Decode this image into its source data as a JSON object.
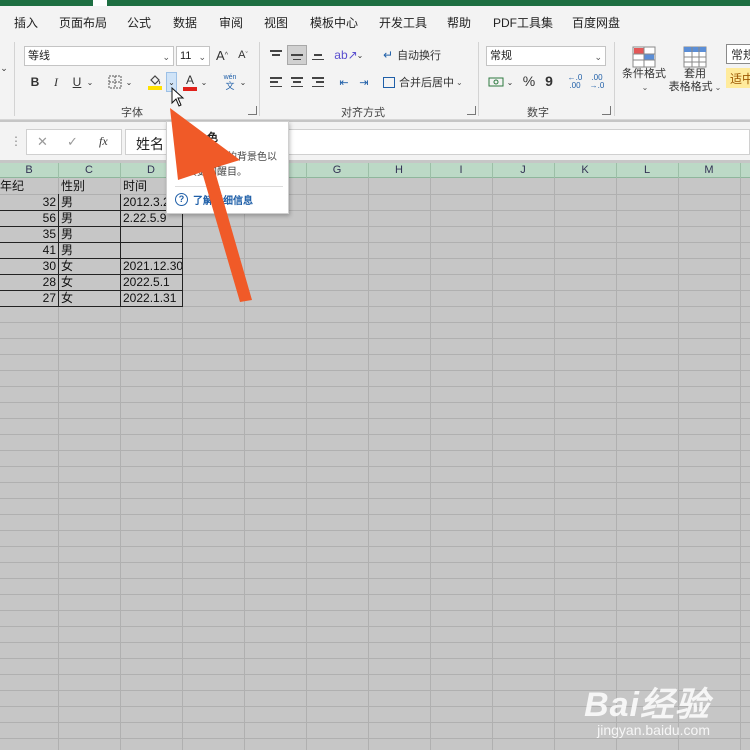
{
  "menu": {
    "tabs": [
      "插入",
      "页面布局",
      "公式",
      "数据",
      "审阅",
      "视图",
      "模板中心",
      "开发工具",
      "帮助",
      "PDF工具集",
      "百度网盘"
    ]
  },
  "ribbon": {
    "font_name": "等线",
    "font_size": "11",
    "grow_font": "A",
    "shrink_font": "A",
    "bold": "B",
    "italic": "I",
    "underline": "U",
    "font_color_letter": "A",
    "phonetic_top": "wén",
    "phonetic_bottom": "文",
    "group_font": "字体",
    "wrap_text": "自动换行",
    "merge_center": "合并后居中",
    "group_alignment": "对齐方式",
    "number_format": "常规",
    "percent": "%",
    "comma": "9",
    "group_number": "数字",
    "cond_format": "条件格式",
    "table_format_1": "套用",
    "table_format_2": "表格格式",
    "style_normal": "常规",
    "style_moderate": "适中",
    "colors": {
      "fill_yellow": "#ffe100",
      "font_red": "#e0201a",
      "menubar_green": "#1e6f42"
    }
  },
  "formula_bar": {
    "cancel": "✕",
    "confirm": "✓",
    "fx": "fx",
    "content": "姓名"
  },
  "columns": [
    "B",
    "C",
    "D",
    "E",
    "F",
    "G",
    "H",
    "I",
    "J",
    "K",
    "L",
    "M"
  ],
  "table": {
    "headers": [
      "年纪",
      "性别",
      "时间"
    ],
    "rows": [
      [
        "32",
        "男",
        "2012.3.2"
      ],
      [
        "56",
        "男",
        "2.22.5.9"
      ],
      [
        "35",
        "男",
        ""
      ],
      [
        "41",
        "男",
        ""
      ],
      [
        "30",
        "女",
        "2021.12.30"
      ],
      [
        "28",
        "女",
        "2022.5.1"
      ],
      [
        "27",
        "女",
        "2022.1.31"
      ]
    ]
  },
  "tooltip": {
    "title": "色",
    "description": "设置单元格的背景色以使其更加醒目。",
    "help_link": "了解详细信息"
  },
  "watermark": {
    "brand": "Bai经验",
    "url": "jingyan.baidu.com"
  }
}
